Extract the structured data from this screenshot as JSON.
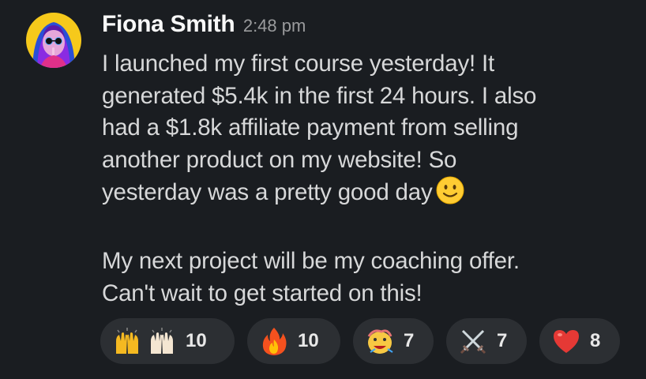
{
  "message": {
    "sender": "Fiona Smith",
    "timestamp": "2:48 pm",
    "body_lines": [
      "I launched my first course yesterday! It",
      "generated $5.4k in the first 24 hours. I also",
      "had a $1.8k affiliate payment from selling",
      "another product on my website! So",
      "yesterday was a pretty good day"
    ],
    "body_emoji": "slightly-smiling-face",
    "body_lines_2": [
      "My next project will be my coaching offer.",
      "Can't wait to get started on this!"
    ]
  },
  "reactions": [
    {
      "icons": [
        "raised-hands-icon",
        "raised-hands-light-icon"
      ],
      "count": "10"
    },
    {
      "icons": [
        "fire-icon"
      ],
      "count": "10"
    },
    {
      "icons": [
        "party-blob-icon"
      ],
      "count": "7"
    },
    {
      "icons": [
        "crossed-swords-icon"
      ],
      "count": "7"
    },
    {
      "icons": [
        "red-heart-icon"
      ],
      "count": "8"
    }
  ],
  "colors": {
    "background": "#1a1d21",
    "reaction_pill": "#2c2f33",
    "sender": "#f8f8f8",
    "timestamp": "#9a9b9d"
  }
}
